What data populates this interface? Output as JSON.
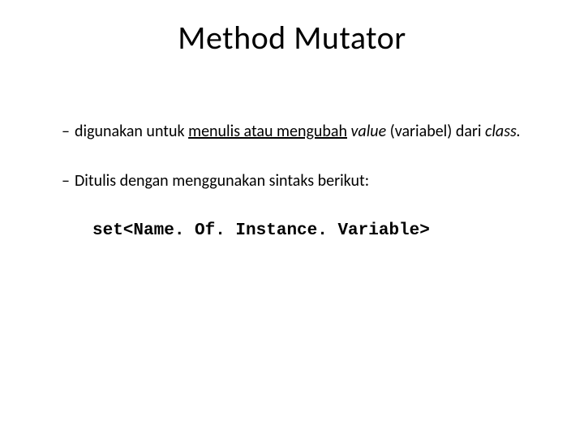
{
  "title": "Method Mutator",
  "bullets": {
    "b1": {
      "dash": "–",
      "pre": "digunakan untuk ",
      "underlined": "menulis atau mengubah",
      "mid": " ",
      "italic1": "value",
      "post1": " (variabel) dari ",
      "italic2": "class.",
      "post2": ""
    },
    "b2": {
      "dash": "–",
      "text": "Ditulis dengan menggunakan sintaks berikut:"
    }
  },
  "code": "set<Name. Of. Instance. Variable>"
}
